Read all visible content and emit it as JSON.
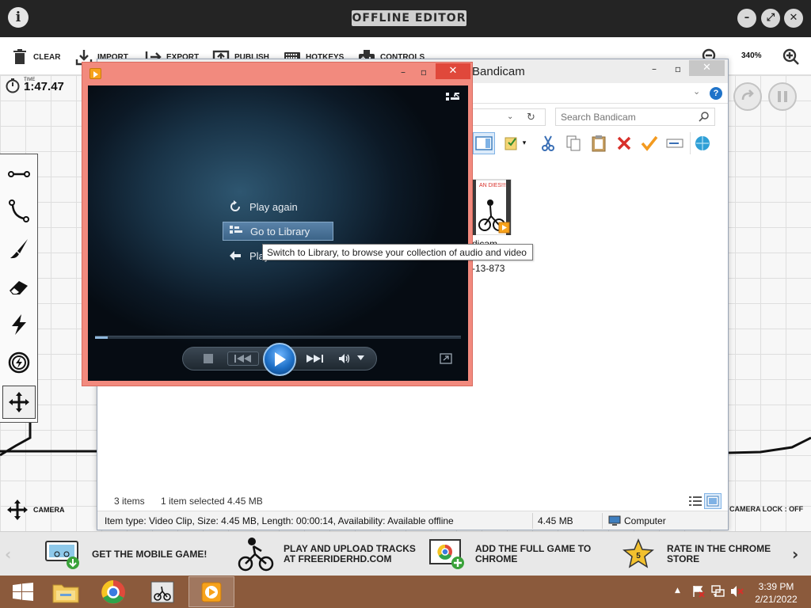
{
  "game": {
    "info_icon": "info-icon",
    "title": "OFFLINE EDITOR",
    "toolbar": [
      {
        "label": "CLEAR",
        "icon": "trash-icon"
      },
      {
        "label": "IMPORT",
        "icon": "import-icon"
      },
      {
        "label": "EXPORT",
        "icon": "export-icon"
      },
      {
        "label": "PUBLISH",
        "icon": "publish-icon"
      },
      {
        "label": "HOTKEYS",
        "icon": "keyboard-icon"
      },
      {
        "label": "CONTROLS",
        "icon": "gamepad-icon"
      }
    ],
    "zoom": "340%",
    "timer": {
      "label": "TIME",
      "value": "1:47.47"
    },
    "camera_label": "CAMERA",
    "camera_lock": "CAMERA LOCK : OFF",
    "tools": [
      "straight-line-icon",
      "curve-icon",
      "brush-icon",
      "eraser-icon",
      "boost-icon",
      "power-up-icon",
      "move-icon"
    ]
  },
  "explorer": {
    "title": "Bandicam",
    "search_placeholder": "Search Bandicam",
    "file": {
      "name": "dicam",
      "sub": "-13-873",
      "thumb_text": "AN DIES!!!"
    },
    "status": {
      "items": "3 items",
      "selected": "1 item selected  4.45 MB"
    },
    "details": {
      "info": "Item type: Video Clip, Size: 4.45 MB, Length: 00:00:14, Availability: Available offline",
      "size": "4.45 MB",
      "location": "Computer"
    }
  },
  "wmp": {
    "menu": [
      {
        "label": "Play again",
        "icon": "replay-icon"
      },
      {
        "label": "Go to Library",
        "icon": "library-icon"
      },
      {
        "label": "Play",
        "icon": "back-arrow-icon"
      }
    ],
    "tooltip": "Switch to Library, to browse your collection of audio and video",
    "progress": 0.035
  },
  "promo": [
    {
      "text": "GET THE MOBILE GAME!"
    },
    {
      "text": "PLAY AND UPLOAD TRACKS\nAT FREERIDERHD.COM"
    },
    {
      "text": "ADD THE FULL GAME TO\nCHROME"
    },
    {
      "text": "RATE IN THE CHROME\nSTORE",
      "badge": "5"
    }
  ],
  "taskbar": {
    "items": [
      "start-icon",
      "file-explorer-icon",
      "chrome-icon",
      "free-rider-icon",
      "media-player-icon"
    ],
    "time": "3:39 PM",
    "date": "2/21/2022"
  },
  "colors": {
    "wmp_frame": "#f28a7e",
    "taskbar": "#8b5a3c",
    "wmp_close": "#e0483b"
  }
}
